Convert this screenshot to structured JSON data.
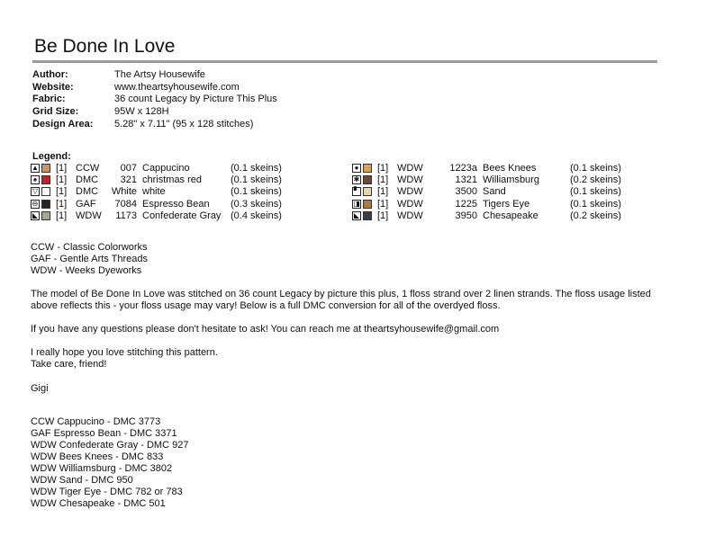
{
  "title": "Be Done In Love",
  "info": [
    {
      "label": "Author:",
      "value": "The Artsy Housewife"
    },
    {
      "label": "Website:",
      "value": "www.theartsyhousewife.com"
    },
    {
      "label": "Fabric:",
      "value": "36 count Legacy by Picture This Plus"
    },
    {
      "label": "Grid Size:",
      "value": "95W x 128H"
    },
    {
      "label": "Design Area:",
      "value": "5.28\" x 7.11\"  (95 x 128 stitches)"
    }
  ],
  "legend_title": "Legend:",
  "legend_left": [
    {
      "symbol": "▲",
      "color": "#c8946a",
      "count": "[1]",
      "maker": "CCW",
      "number": "007",
      "name": "Cappucino",
      "qty": "(0.1 skeins)"
    },
    {
      "symbol": "♠",
      "color": "#c8202a",
      "count": "[1]",
      "maker": "DMC",
      "number": "321",
      "name": "christmas red",
      "qty": "(0.1 skeins)"
    },
    {
      "symbol": "▽",
      "color": "#ffffff",
      "count": "[1]",
      "maker": "DMC",
      "number": "White",
      "name": "white",
      "qty": "(0.1 skeins)"
    },
    {
      "symbol": "⊖",
      "color": "#2a2220",
      "count": "[1]",
      "maker": "GAF",
      "number": "7084",
      "name": "Espresso Bean",
      "qty": "(0.3 skeins)"
    },
    {
      "symbol": "◣",
      "color": "#a8a890",
      "count": "[1]",
      "maker": "WDW",
      "number": "1173",
      "name": "Confederate Gray",
      "qty": "(0.4 skeins)"
    }
  ],
  "legend_right": [
    {
      "symbol": "●",
      "color": "#d8a450",
      "count": "[1]",
      "maker": "WDW",
      "number": "1223a",
      "name": "Bees Knees",
      "qty": "(0.1 skeins)"
    },
    {
      "symbol": "✱",
      "color": "#6a4a36",
      "count": "[1]",
      "maker": "WDW",
      "number": "1321",
      "name": "Williamsburg",
      "qty": "(0.2 skeins)"
    },
    {
      "symbol": "▘",
      "color": "#e8d6a8",
      "count": "[1]",
      "maker": "WDW",
      "number": "3500",
      "name": "Sand",
      "qty": "(0.1 skeins)"
    },
    {
      "symbol": "◨",
      "color": "#b07a38",
      "count": "[1]",
      "maker": "WDW",
      "number": "1225",
      "name": "Tigers Eye",
      "qty": "(0.1 skeins)"
    },
    {
      "symbol": "◣",
      "color": "#3a3e44",
      "count": "[1]",
      "maker": "WDW",
      "number": "3950",
      "name": "Chesapeake",
      "qty": "(0.2 skeins)"
    }
  ],
  "abbreviations": [
    "CCW - Classic Colorworks",
    "GAF - Gentle Arts Threads",
    "WDW - Weeks Dyeworks"
  ],
  "paragraph1_line1": "The model of Be Done In Love was stitched on 36 count Legacy by picture this plus, 1 floss strand over 2 linen strands. The floss usage listed",
  "paragraph1_line2": "above reflects this - your floss usage may vary! Below is a full DMC conversion for all of the overdyed floss.",
  "paragraph2": "If you have any questions please don't hesitate to ask! You can reach me at theartsyhousewife@gmail.com",
  "closing_line1": "I really hope you love stitching this pattern.",
  "closing_line2": "Take care, friend!",
  "signature": "Gigi",
  "conversions": [
    "CCW Cappucino - DMC 3773",
    "GAF Espresso Bean - DMC 3371",
    "WDW Confederate Gray - DMC 927",
    "WDW Bees Knees - DMC 833",
    "WDW Williamsburg - DMC 3802",
    "WDW Sand - DMC 950",
    "WDW Tiger Eye - DMC 782 or 783",
    "WDW Chesapeake - DMC 501"
  ]
}
